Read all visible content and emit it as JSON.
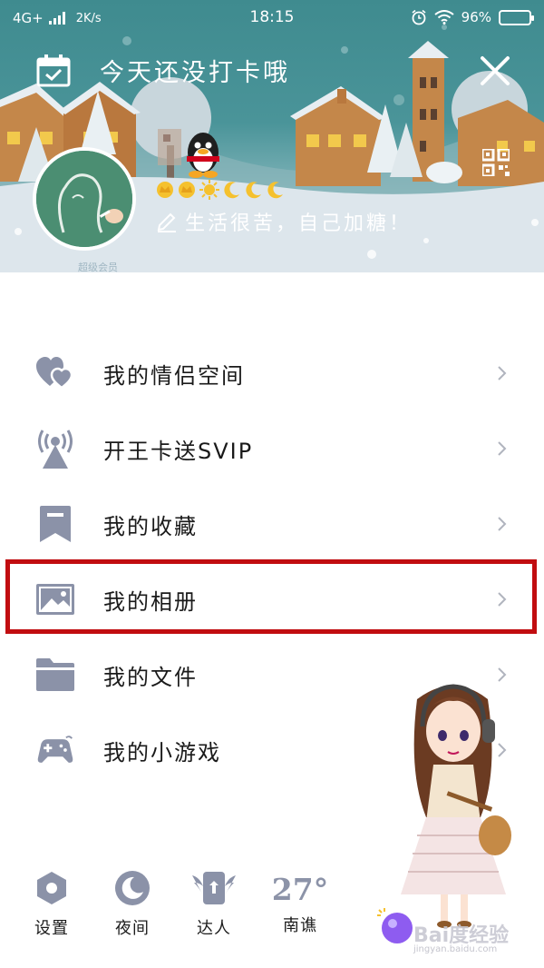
{
  "status_bar": {
    "network": "4G+",
    "speed": "2K/s",
    "time": "18:15",
    "battery": "96%",
    "battery_level": 0.96
  },
  "header": {
    "checkin_text": "今天还没打卡哦",
    "signature": "生活很苦，自己加糖！",
    "vip_mark": "超级会员"
  },
  "menu": {
    "items": [
      {
        "label": "我的情侣空间",
        "icon": "hearts-icon"
      },
      {
        "label": "开王卡送SVIP",
        "icon": "signal-tower-icon"
      },
      {
        "label": "我的收藏",
        "icon": "bookmark-icon"
      },
      {
        "label": "我的相册",
        "icon": "image-icon"
      },
      {
        "label": "我的文件",
        "icon": "folder-icon"
      },
      {
        "label": "我的小游戏",
        "icon": "gamepad-icon"
      }
    ],
    "highlighted_index": 3
  },
  "bottom_bar": {
    "settings_label": "设置",
    "night_label": "夜间",
    "expert_label": "达人",
    "temperature": "27°",
    "city": "南谯"
  },
  "watermark": {
    "text": "Bai度经验",
    "sub": "jingyan.baidu.com"
  },
  "colors": {
    "icon_gray": "#8b92a8",
    "highlight_red": "#c10d10",
    "header_teal": "#4a9499"
  }
}
